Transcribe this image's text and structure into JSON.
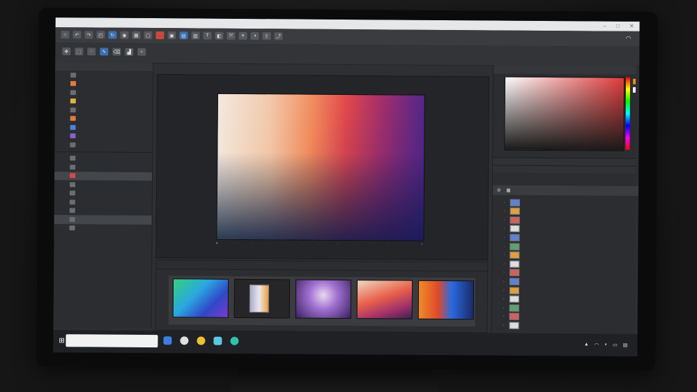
{
  "titlebar": {
    "menu": [
      "",
      "",
      "",
      "",
      "",
      "",
      ""
    ]
  },
  "left_panel": {
    "items": [
      {
        "label": "",
        "icon": "file-icon"
      },
      {
        "label": "",
        "icon": "folder-icon"
      },
      {
        "label": "",
        "icon": "layers-icon"
      },
      {
        "label": "",
        "icon": "image-icon"
      },
      {
        "label": "",
        "icon": "folder-icon"
      },
      {
        "label": "",
        "icon": "image-icon"
      },
      {
        "label": "",
        "icon": "settings-icon"
      },
      {
        "label": "",
        "icon": "file-icon"
      }
    ]
  },
  "canvas": {
    "label": ""
  },
  "thumbnails": {
    "items": [
      {
        "caption": ""
      },
      {
        "caption": ""
      },
      {
        "caption": ""
      },
      {
        "caption": ""
      },
      {
        "caption": ""
      }
    ]
  },
  "right_panel": {
    "layers": [
      {
        "label": ""
      },
      {
        "label": ""
      },
      {
        "label": ""
      },
      {
        "label": ""
      },
      {
        "label": ""
      },
      {
        "label": ""
      },
      {
        "label": ""
      },
      {
        "label": ""
      },
      {
        "label": ""
      },
      {
        "label": ""
      },
      {
        "label": ""
      },
      {
        "label": ""
      },
      {
        "label": ""
      },
      {
        "label": ""
      },
      {
        "label": ""
      }
    ]
  },
  "taskbar": {
    "search_placeholder": ""
  },
  "colors": {
    "accent": "#e07d3a",
    "panel": "#2b2d31",
    "toolbar": "#3a3c40"
  }
}
